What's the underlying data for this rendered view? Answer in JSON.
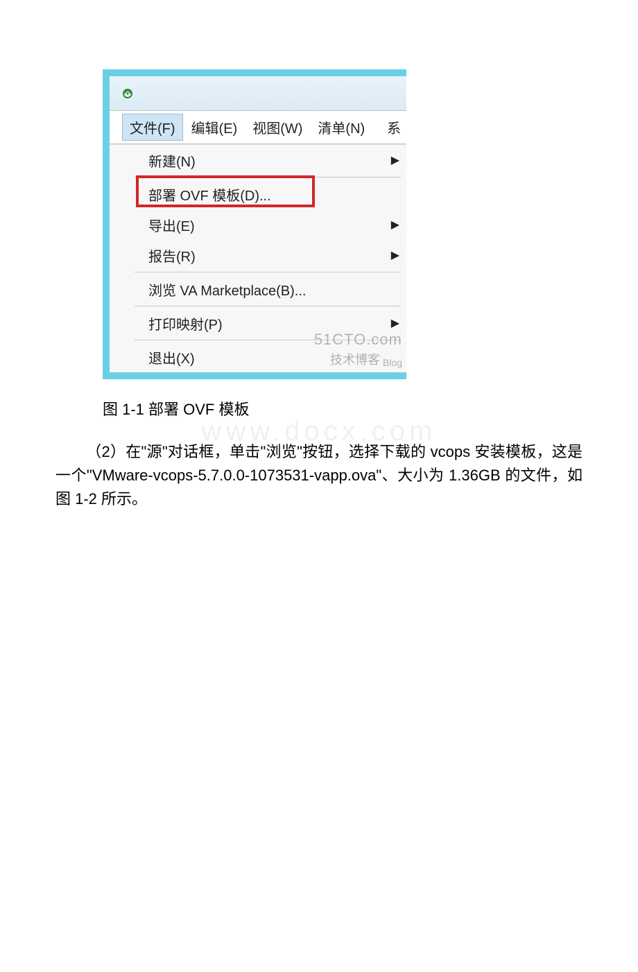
{
  "menubar": {
    "file": "文件(F)",
    "edit": "编辑(E)",
    "view": "视图(W)",
    "inventory": "清单(N)",
    "tail": "系"
  },
  "menu": {
    "new": "新建(N)",
    "deploy_ovf": "部署 OVF 模板(D)...",
    "export": "导出(E)",
    "report": "报告(R)",
    "browse_marketplace": "浏览 VA Marketplace(B)...",
    "print_maps": "打印映射(P)",
    "exit": "退出(X)"
  },
  "watermarks": {
    "brand": "51CTO.com",
    "cn": "技术博客",
    "blog": "Blog",
    "doc": "www.docx.com"
  },
  "caption": "图 1-1 部署 OVF 模板",
  "paragraph": {
    "prefix": "（2）在\"源\"对话框，单击\"浏览\"按钮，选择下载的 vcops 安装模板，这是一个\"VMware-vcops-5.7.0.0-1073531-vapp.ova\"、大小为 1.36GB 的文件，如图 1-2 所示。"
  }
}
